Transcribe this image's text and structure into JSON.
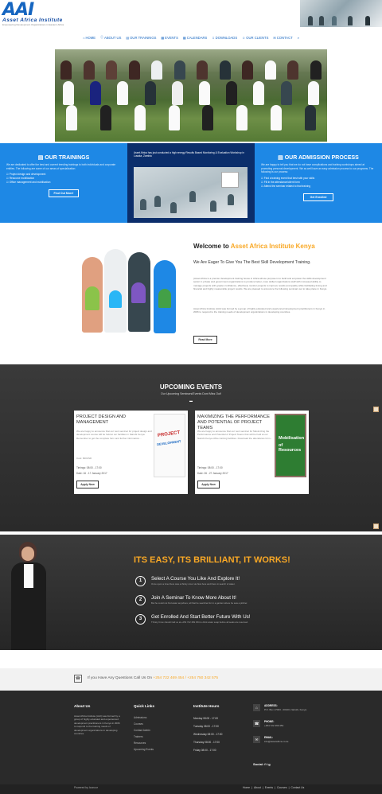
{
  "logo": {
    "mark": "AAI",
    "name": "Asset Africa Institute",
    "tagline": "Empowering Development Organizations in Eastern Africa"
  },
  "nav": [
    {
      "icon": "home-icon",
      "glyph": "⌂",
      "label": "Home"
    },
    {
      "icon": "info-icon",
      "glyph": "ⓘ",
      "label": "About Us"
    },
    {
      "icon": "book-icon",
      "glyph": "▤",
      "label": "Our Trainings"
    },
    {
      "icon": "calendar-icon",
      "glyph": "▦",
      "label": "Events"
    },
    {
      "icon": "calendar-icon",
      "glyph": "▦",
      "label": "Calendars"
    },
    {
      "icon": "download-icon",
      "glyph": "⇩",
      "label": "Downloads"
    },
    {
      "icon": "users-icon",
      "glyph": "☺",
      "label": "Our Clients"
    },
    {
      "icon": "mail-icon",
      "glyph": "✉",
      "label": "Contact"
    }
  ],
  "trainings": {
    "title": "Our Trainings",
    "text": "We are dedicated to offer the best and current trending trainings to both individuals and corporate entities. The following are some of our areas of specialization:",
    "items": [
      "Project design and development",
      "Resource mobilization",
      "Office management and mobilization"
    ],
    "button": "Find Out More!"
  },
  "mid": {
    "caption": "Asset Africa has just conducted a high energy Results Based Monitoring & Evaluation Workshop in Lusaka, Zambia"
  },
  "admission": {
    "title": "Our Admission Process",
    "text": "We are happy to tell you that we do not have complications and training workshops aimed at promoting personal development. We as well have an easy admission process to our programs. The following is our process:",
    "items": [
      "Find a training event that best with your skills",
      "Fill in the attendance/client form",
      "Attend the seminar related to that training"
    ],
    "button": "Get Enrolled"
  },
  "welcome": {
    "title_plain": "Welcome to ",
    "title_accent": "Asset Africa Institute Kenya",
    "subtitle": "We Are Eager To Give You The Best Skill Development Training.",
    "para1": "(Asset Africa is a premier development training house in Africa whose purpose is to build and empower the skills development sector in private and government organizations to produce better, more skilled organizations staff with increased ability to manage projects with greater confidence, effectively monitor projects to improve results and quality while facilitating timing and financial and highly measurable project results. We are pleased to announce the following seminars set to take place in Kenya.",
    "para2": "Asset Africa Institute (AAI) was formed by a group of highly educated and experienced development practitioners in Kenya in 2006 to respond to the training needs of development organizations in developing countries.",
    "button": "Read More"
  },
  "events": {
    "title": "Upcoming Events",
    "subtitle": "Our Upcoming Seminars/Events Dont Miss Out!",
    "cards": [
      {
        "title": "Project Design and Management",
        "desc": "We are happy to announce that our next seminar for project design and development course will be held at our facilities in Nairobi Kenya. Remember to get the complete form and further information...",
        "cost": "Cost: 600USD",
        "timings": "Timings: 08:00 - 17:00",
        "dates": "Date: 16 - 17 January 2017",
        "button": "Apply Now",
        "image_label_1": "PROJECT",
        "image_label_2": "DEVELOPMENT"
      },
      {
        "title": "Maximizing the Performance and Potential of Project Teams",
        "desc": "We are happy to announce that our next seminar for Maximizing the Performance and Potential of Project Teams that will be held at our Nairobi Kenya office training facilities. Download the attendance form...",
        "cost": "Cost: 600USD",
        "timings": "Timings: 08:00 - 17:00",
        "dates": "Date: 26 - 27 January 2017",
        "button": "Apply Now",
        "image_label_1": "Mobilisation",
        "image_label_2": "of Resources"
      }
    ]
  },
  "easy": {
    "title": "Its Easy, Its Brilliant, It Works!",
    "steps": [
      {
        "n": "1",
        "title": "Select A Course You Like And Explore It!",
        "desc": "Once upon a time there was a thirsty crow. He flew here and there in search of water."
      },
      {
        "n": "2",
        "title": "Join A Seminar To Know More About It!",
        "desc": "But he could not find water anywhere; all that he searched for in a garden where he saw a pitcher."
      },
      {
        "n": "3",
        "title": "Get Enrolled And Start Better Future With Us!",
        "desc": "Thirsty Crow should Call us at +254 722 469 454 to drink water soap before all seats are reserved."
      }
    ]
  },
  "call": {
    "text": "If you Have Any Questions Call Us On ",
    "numbers": "+254 722 469 454 / +254 750 342 575"
  },
  "footer": {
    "about_title": "About Us",
    "about_text": "Asset Africa Institute (AAI) was formed by a group of highly educated and experienced development practitioners in Kenya in 2006 to respond to the training needs of development organizations in developing countries.",
    "links_title": "Quick Links",
    "links": [
      "Admissions",
      "Courses",
      "Contact Admin",
      "Trainers",
      "Resources",
      "Upcoming Events"
    ],
    "hours_title": "Institute Hours",
    "hours": [
      "Monday 08:00 - 17:00",
      "Tuesday 08:00 - 17:00",
      "Wednesday 08:00 - 17:00",
      "Thursday 08:00 - 17:00",
      "Friday 08:00 - 17:00"
    ],
    "contact": [
      {
        "label": "ADDRESS:",
        "value": "P.O. Box 17003 - 00100, Nairobi, Kenya"
      },
      {
        "label": "PHONE:",
        "value": "+254 722 469 454"
      },
      {
        "label": "EMAIL:",
        "value": "info@assetafrica.co.ke"
      }
    ],
    "social": "Social:",
    "powered": "Powered by Iconcor",
    "bottom_links": [
      "Home",
      "About",
      "Events",
      "Courses",
      "Contact Us"
    ]
  }
}
